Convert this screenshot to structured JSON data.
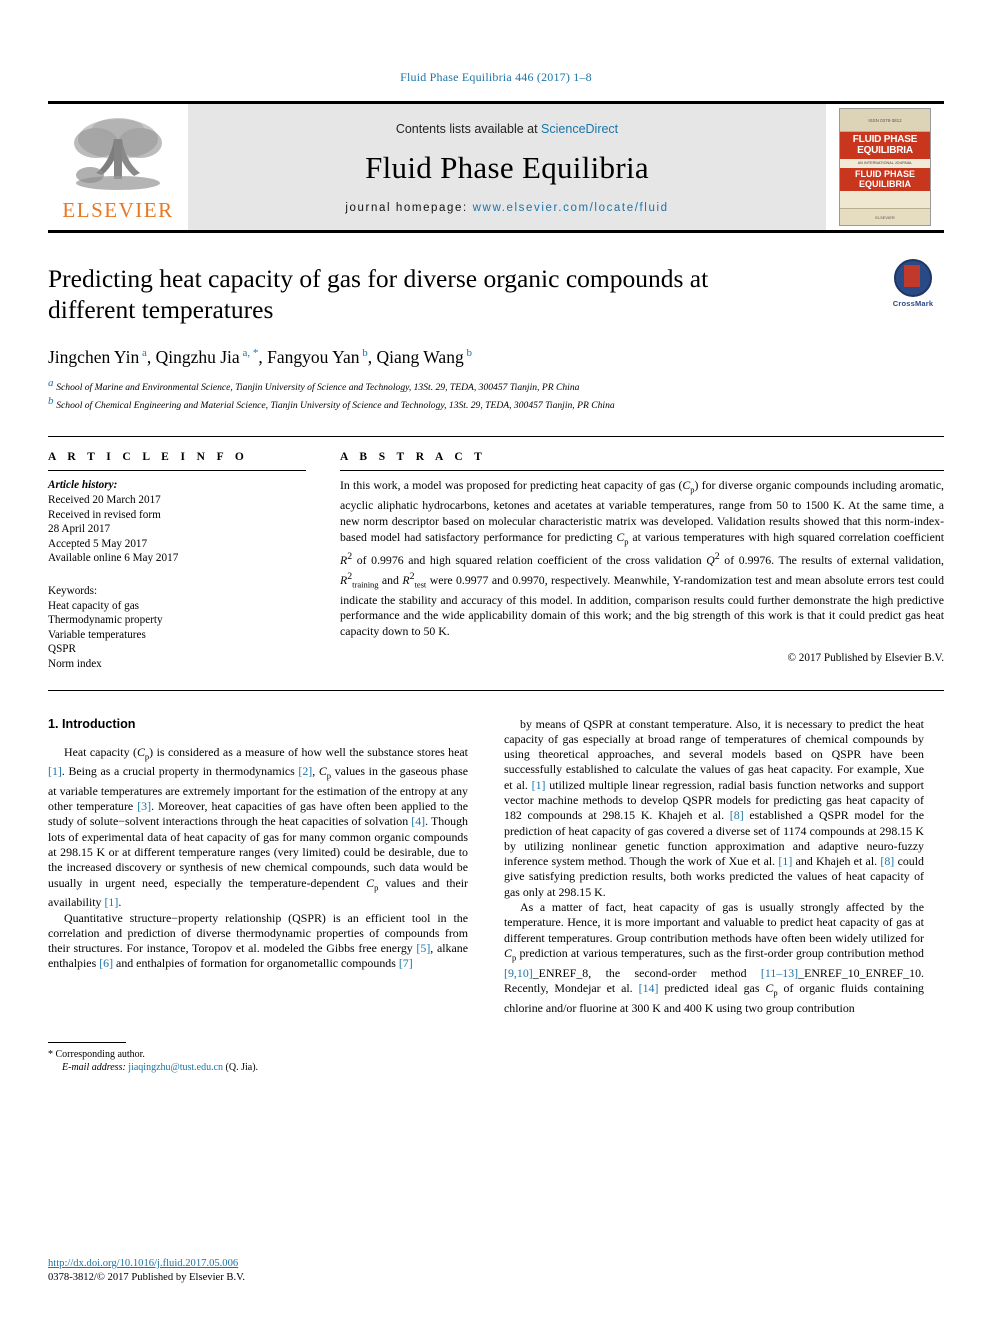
{
  "running_head": "Fluid Phase Equilibria 446 (2017) 1–8",
  "masthead": {
    "contents_prefix": "Contents lists available at ",
    "contents_link": "ScienceDirect",
    "journal_title": "Fluid Phase Equilibria",
    "homepage_prefix": "journal homepage: ",
    "homepage_url": "www.elsevier.com/locate/fluid",
    "publisher": "ELSEVIER",
    "cover": {
      "top_label": "ISSN 0378-3812",
      "band1": "FLUID PHASE EQUILIBRIA",
      "sub": "AN INTERNATIONAL JOURNAL",
      "band2": "FLUID PHASE EQUILIBRIA",
      "foot_label": "ELSEVIER"
    }
  },
  "article": {
    "title": "Predicting heat capacity of gas for diverse organic compounds at different temperatures",
    "crossmark_label": "CrossMark",
    "authors": [
      {
        "name": "Jingchen Yin",
        "marks": "a"
      },
      {
        "name": "Qingzhu Jia",
        "marks": "a, *"
      },
      {
        "name": "Fangyou Yan",
        "marks": "b"
      },
      {
        "name": "Qiang Wang",
        "marks": "b"
      }
    ],
    "affiliations": [
      {
        "mark": "a",
        "text": "School of Marine and Environmental Science, Tianjin University of Science and Technology, 13St. 29, TEDA, 300457 Tianjin, PR China"
      },
      {
        "mark": "b",
        "text": "School of Chemical Engineering and Material Science, Tianjin University of Science and Technology, 13St. 29, TEDA, 300457 Tianjin, PR China"
      }
    ]
  },
  "article_info": {
    "heading": "A R T I C L E  I N F O",
    "history_label": "Article history:",
    "history": [
      "Received 20 March 2017",
      "Received in revised form",
      "28 April 2017",
      "Accepted 5 May 2017",
      "Available online 6 May 2017"
    ],
    "keywords_label": "Keywords:",
    "keywords": [
      "Heat capacity of gas",
      "Thermodynamic property",
      "Variable temperatures",
      "QSPR",
      "Norm index"
    ]
  },
  "abstract": {
    "heading": "A B S T R A C T",
    "paragraph_1": "In this work, a model was proposed for predicting heat capacity of gas (",
    "cp_symbol": "C",
    "cp_sub": "p",
    "paragraph_2": ") for diverse organic compounds including aromatic, acyclic aliphatic hydrocarbons, ketones and acetates at variable temperatures, range from 50 to 1500 K. At the same time, a new norm descriptor based on molecular characteristic matrix was developed. Validation results showed that this norm-index-based model had satisfactory performance for predicting ",
    "paragraph_3": " at various temperatures with high squared correlation coefficient ",
    "r2": "R",
    "sup2": "2",
    "paragraph_4": " of 0.9976 and high squared relation coefficient of the cross validation ",
    "q2": "Q",
    "paragraph_5": " of 0.9976. The results of external validation, ",
    "r2_training_sub": "training",
    "paragraph_6": " and ",
    "r2_test_sub": "test",
    "paragraph_7": " were 0.9977 and 0.9970, respectively. Meanwhile, Y-randomization test and mean absolute errors test could indicate the stability and accuracy of this model. In addition, comparison results could further demonstrate the high predictive performance and the wide applicability domain of this work; and the big strength of this work is that it could predict gas heat capacity down to 50 K.",
    "copyright": "© 2017 Published by Elsevier B.V."
  },
  "introduction": {
    "section_number": "1.",
    "section_title": "Introduction",
    "left_column": [
      {
        "id": "p1",
        "segments": [
          {
            "t": "Heat capacity ("
          },
          {
            "t": "C",
            "style": "italic"
          },
          {
            "t": "p",
            "style": "sub"
          },
          {
            "t": ") is considered as a measure of how well the substance stores heat "
          },
          {
            "t": "[1]",
            "style": "ref"
          },
          {
            "t": ". Being as a crucial property in thermodynamics "
          },
          {
            "t": "[2]",
            "style": "ref"
          },
          {
            "t": ", "
          },
          {
            "t": "C",
            "style": "italic"
          },
          {
            "t": "p",
            "style": "sub"
          },
          {
            "t": " values in the gaseous phase at variable temperatures are extremely important for the estimation of the entropy at any other temperature "
          },
          {
            "t": "[3]",
            "style": "ref"
          },
          {
            "t": ". Moreover, heat capacities of gas have often been applied to the study of solute−solvent interactions through the heat capacities of solvation "
          },
          {
            "t": "[4]",
            "style": "ref"
          },
          {
            "t": ". Though lots of experimental data of heat capacity of gas for many common organic compounds at 298.15 K or at different temperature ranges (very limited) could be desirable, due to the increased discovery or synthesis of new chemical compounds, such data would be usually in urgent need, especially the temperature-dependent "
          },
          {
            "t": "C",
            "style": "italic"
          },
          {
            "t": "p",
            "style": "sub"
          },
          {
            "t": " values and their availability "
          },
          {
            "t": "[1]",
            "style": "ref"
          },
          {
            "t": "."
          }
        ]
      },
      {
        "id": "p2",
        "segments": [
          {
            "t": "Quantitative structure−property relationship (QSPR) is an efficient tool in the correlation and prediction of diverse thermodynamic properties of compounds from their structures. For instance, Toropov et al. modeled the Gibbs free energy "
          },
          {
            "t": "[5]",
            "style": "ref"
          },
          {
            "t": ", alkane enthalpies "
          },
          {
            "t": "[6]",
            "style": "ref"
          },
          {
            "t": " and enthalpies of formation for organometallic compounds "
          },
          {
            "t": "[7]",
            "style": "ref"
          }
        ]
      }
    ],
    "right_column": [
      {
        "id": "p3",
        "segments": [
          {
            "t": "by means of QSPR at constant temperature. Also, it is necessary to predict the heat capacity of gas especially at broad range of temperatures of chemical compounds by using theoretical approaches, and several models based on QSPR have been successfully established to calculate the values of gas heat capacity. For example, Xue et al. "
          },
          {
            "t": "[1]",
            "style": "ref"
          },
          {
            "t": " utilized multiple linear regression, radial basis function networks and support vector machine methods to develop QSPR models for predicting gas heat capacity of 182 compounds at 298.15 K. Khajeh et al. "
          },
          {
            "t": "[8]",
            "style": "ref"
          },
          {
            "t": " established a QSPR model for the prediction of heat capacity of gas covered a diverse set of 1174 compounds at 298.15 K by utilizing nonlinear genetic function approximation and adaptive neuro-fuzzy inference system method. Though the work of Xue et al. "
          },
          {
            "t": "[1]",
            "style": "ref"
          },
          {
            "t": " and Khajeh et al. "
          },
          {
            "t": "[8]",
            "style": "ref"
          },
          {
            "t": " could give satisfying prediction results, both works predicted the values of heat capacity of gas only at 298.15 K."
          }
        ]
      },
      {
        "id": "p4",
        "segments": [
          {
            "t": "As a matter of fact, heat capacity of gas is usually strongly affected by the temperature. Hence, it is more important and valuable to predict heat capacity of gas at different temperatures. Group contribution methods have often been widely utilized for "
          },
          {
            "t": "C",
            "style": "italic"
          },
          {
            "t": "p",
            "style": "sub"
          },
          {
            "t": " prediction at various temperatures, such as the first-order group contribution method "
          },
          {
            "t": "[9,10]",
            "style": "ref"
          },
          {
            "t": "_ENREF_8, the second-order method "
          },
          {
            "t": "[11–13]",
            "style": "ref"
          },
          {
            "t": "_ENREF_10_ENREF_10. Recently, Mondejar et al. "
          },
          {
            "t": "[14]",
            "style": "ref"
          },
          {
            "t": " predicted ideal gas "
          },
          {
            "t": "C",
            "style": "italic"
          },
          {
            "t": "p",
            "style": "sub"
          },
          {
            "t": " of organic fluids containing chlorine and/or fluorine at 300 K and 400 K using two group contribution"
          }
        ]
      }
    ]
  },
  "footnote": {
    "marker": "*",
    "corresponding": "Corresponding author.",
    "email_label": "E-mail address:",
    "email": "jiaqingzhu@tust.edu.cn",
    "email_owner": "(Q. Jia)."
  },
  "footer": {
    "doi": "http://dx.doi.org/10.1016/j.fluid.2017.05.006",
    "issn_line": "0378-3812/© 2017 Published by Elsevier B.V."
  },
  "colors": {
    "link": "#1b75a8",
    "elsevier_orange": "#E87722",
    "cover_red": "#c8371d",
    "crossmark_blue": "#2a4a86"
  }
}
